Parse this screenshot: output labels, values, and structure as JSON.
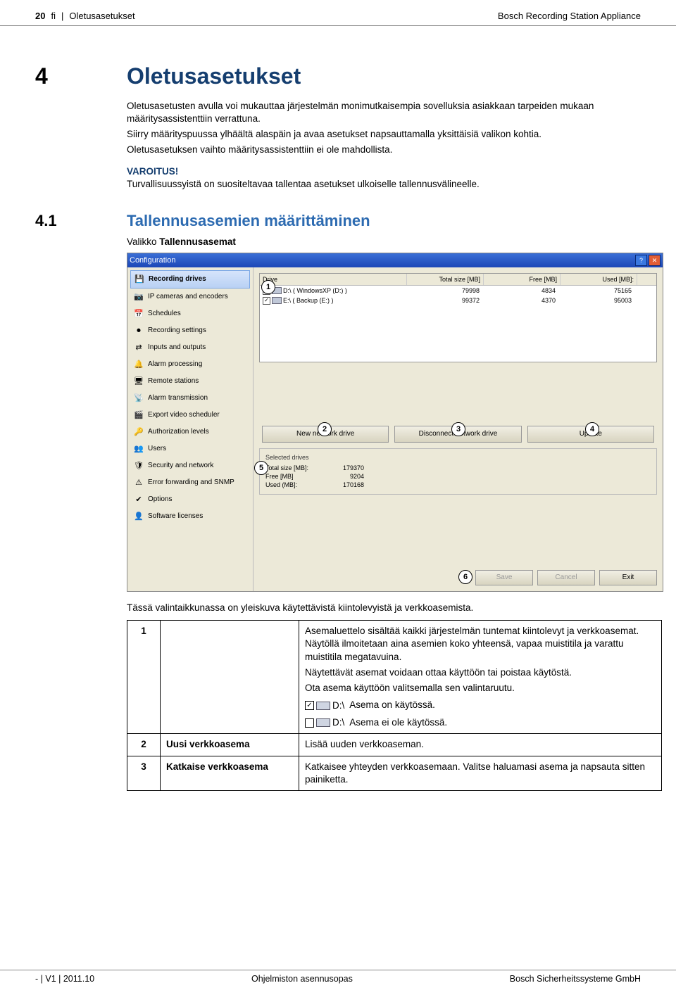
{
  "header": {
    "page_no": "20",
    "lang": "fi",
    "breadcrumb": "Oletusasetukset",
    "product": "Bosch Recording Station Appliance"
  },
  "section4": {
    "num": "4",
    "title": "Oletusasetukset",
    "para1": "Oletusasetusten avulla voi mukauttaa järjestelmän monimutkaisempia sovelluksia asiakkaan tarpeiden mukaan määritysassistenttiin verrattuna.",
    "para2": "Siirry määrityspuussa ylhäältä alaspäin ja avaa asetukset napsauttamalla yksittäisiä valikon kohtia.",
    "para3": "Oletusasetuksen vaihto määritysassistenttiin ei ole mahdollista.",
    "warn_label": "VAROITUS!",
    "warn_text": "Turvallisuussyistä on suositeltavaa tallentaa asetukset ulkoiselle tallennusvälineelle."
  },
  "section41": {
    "num": "4.1",
    "title": "Tallennusasemien määrittäminen",
    "valikko_pre": "Valikko ",
    "valikko_bold": "Tallennusasemat"
  },
  "screenshot": {
    "title": "Configuration",
    "sidebar": [
      "Recording drives",
      "IP cameras and encoders",
      "Schedules",
      "Recording settings",
      "Inputs and outputs",
      "Alarm processing",
      "Remote stations",
      "Alarm transmission",
      "Export video scheduler",
      "Authorization levels",
      "Users",
      "Security and network",
      "Error forwarding and SNMP",
      "Options",
      "Software licenses"
    ],
    "drive_header": {
      "c1": "Drive",
      "c2": "Total size [MB]",
      "c3": "Free [MB]",
      "c4": "Used [MB]:"
    },
    "drives": [
      {
        "chk": "✓",
        "name": "D:\\ ( WindowsXP (D:) )",
        "total": "79998",
        "free": "4834",
        "used": "75165"
      },
      {
        "chk": "✓",
        "name": "E:\\ ( Backup (E:) )",
        "total": "99372",
        "free": "4370",
        "used": "95003"
      }
    ],
    "btn_new": "New network drive",
    "btn_disc": "Disconnect network drive",
    "btn_upd": "Update",
    "sel_header": "Selected drives",
    "sel_rows": [
      {
        "l": "Total size [MB]:",
        "v": "179370"
      },
      {
        "l": "Free [MB]",
        "v": "9204"
      },
      {
        "l": "Used (MB]:",
        "v": "170168"
      }
    ],
    "bottom": {
      "save": "Save",
      "cancel": "Cancel",
      "exit": "Exit"
    }
  },
  "callouts": {
    "c1": "1",
    "c2": "2",
    "c3": "3",
    "c4": "4",
    "c5": "5",
    "c6": "6"
  },
  "caption": "Tässä valintaikkunassa on yleiskuva käytettävistä kiintolevyistä ja verkkoasemista.",
  "table": {
    "r1": {
      "n": "1",
      "label": "",
      "t1": "Asemaluettelo sisältää kaikki järjestelmän tuntemat kiintolevyt ja verkkoasemat. Näytöllä ilmoitetaan aina asemien koko yhteensä, vapaa muistitila ja varattu muistitila megatavuina.",
      "t2": "Näytettävät asemat voidaan ottaa käyttöön tai poistaa käytöstä.",
      "t3": "Ota asema käyttöön valitsemalla sen valintaruutu.",
      "d1_label": "D:\\",
      "d1_text": " Asema on käytössä.",
      "d2_label": "D:\\",
      "d2_text": " Asema ei ole käytössä."
    },
    "r2": {
      "n": "2",
      "label": "Uusi verkkoasema",
      "text": "Lisää uuden verkkoaseman."
    },
    "r3": {
      "n": "3",
      "label": "Katkaise verkkoasema",
      "text": "Katkaisee yhteyden verkkoasemaan. Valitse haluamasi asema ja napsauta sitten painiketta."
    }
  },
  "footer": {
    "left": "- | V1 | 2011.10",
    "center": "Ohjelmiston asennusopas",
    "right": "Bosch Sicherheitssysteme GmbH"
  }
}
